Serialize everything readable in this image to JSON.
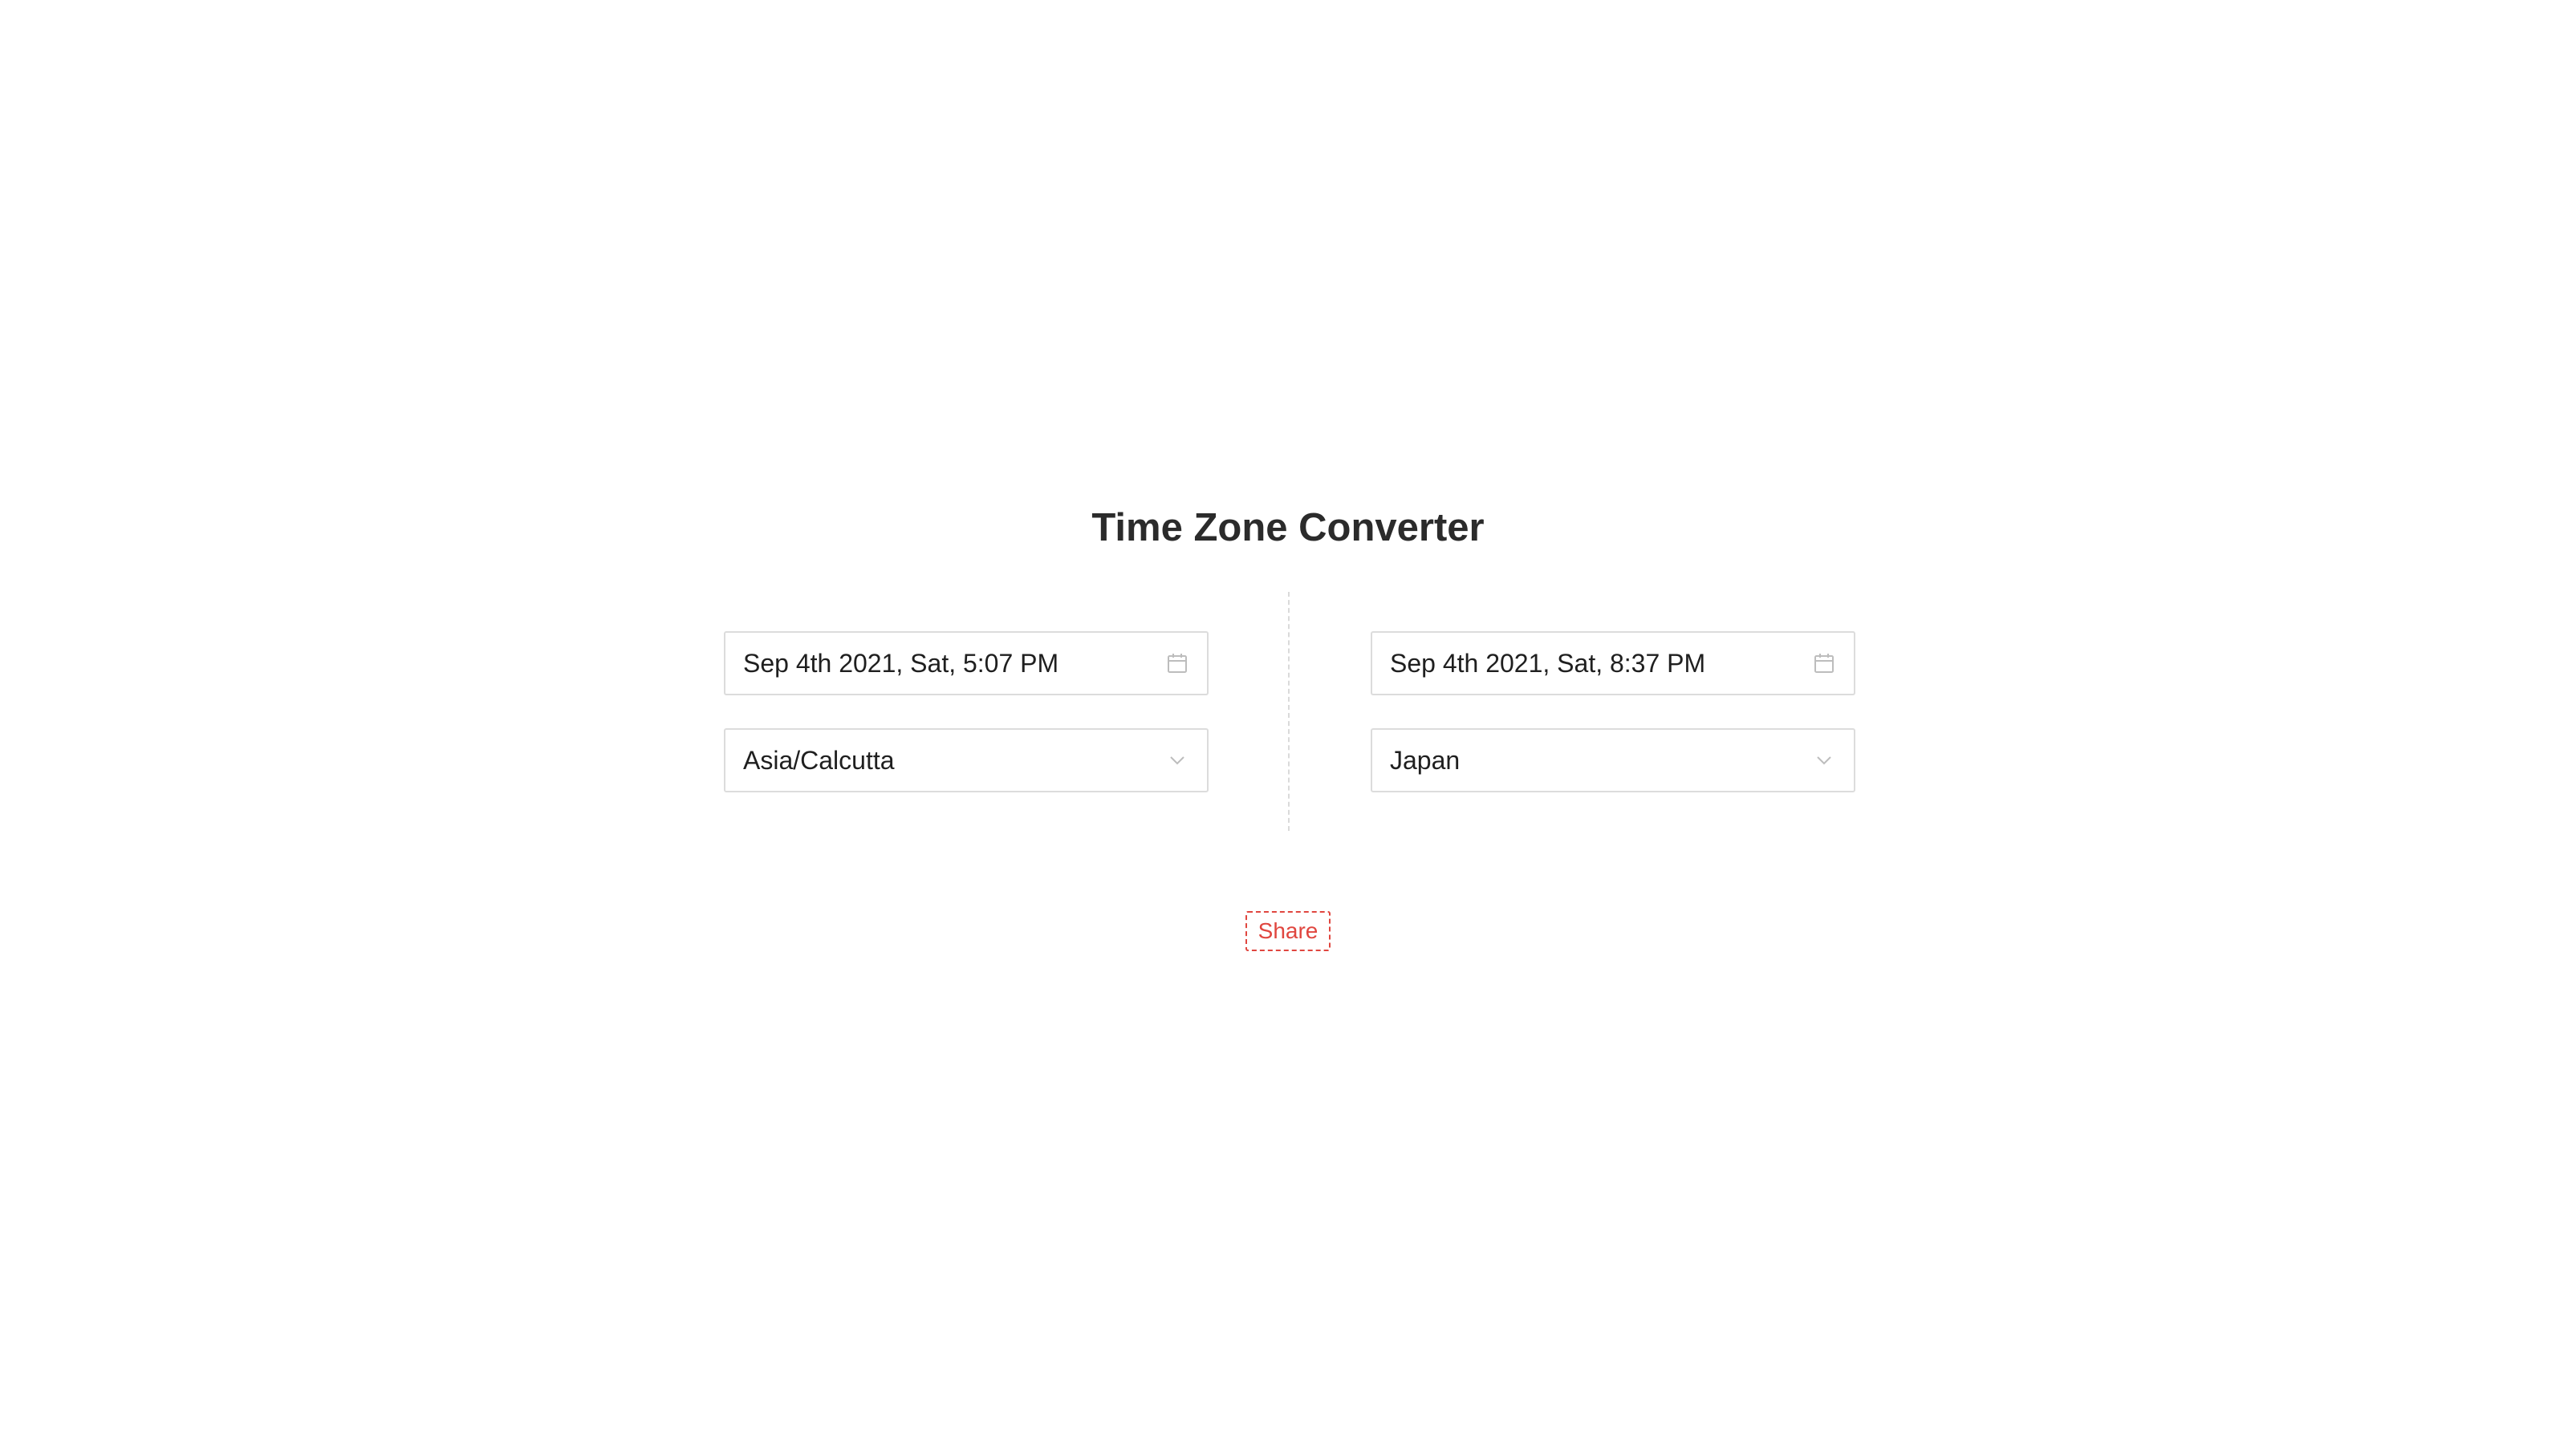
{
  "page": {
    "title": "Time Zone Converter"
  },
  "converter": {
    "left": {
      "datetime_value": "Sep 4th 2021, Sat, 5:07 PM",
      "timezone_value": "Asia/Calcutta"
    },
    "right": {
      "datetime_value": "Sep 4th 2021, Sat, 8:37 PM",
      "timezone_value": "Japan"
    }
  },
  "actions": {
    "share_label": "Share"
  },
  "icons": {
    "datetime": "calendar-icon",
    "timezone": "chevron-down-icon"
  },
  "colors": {
    "accent": "#e0463f",
    "border": "#dcdcdc",
    "text": "#1f1f1f",
    "title": "#2b2b2b"
  }
}
